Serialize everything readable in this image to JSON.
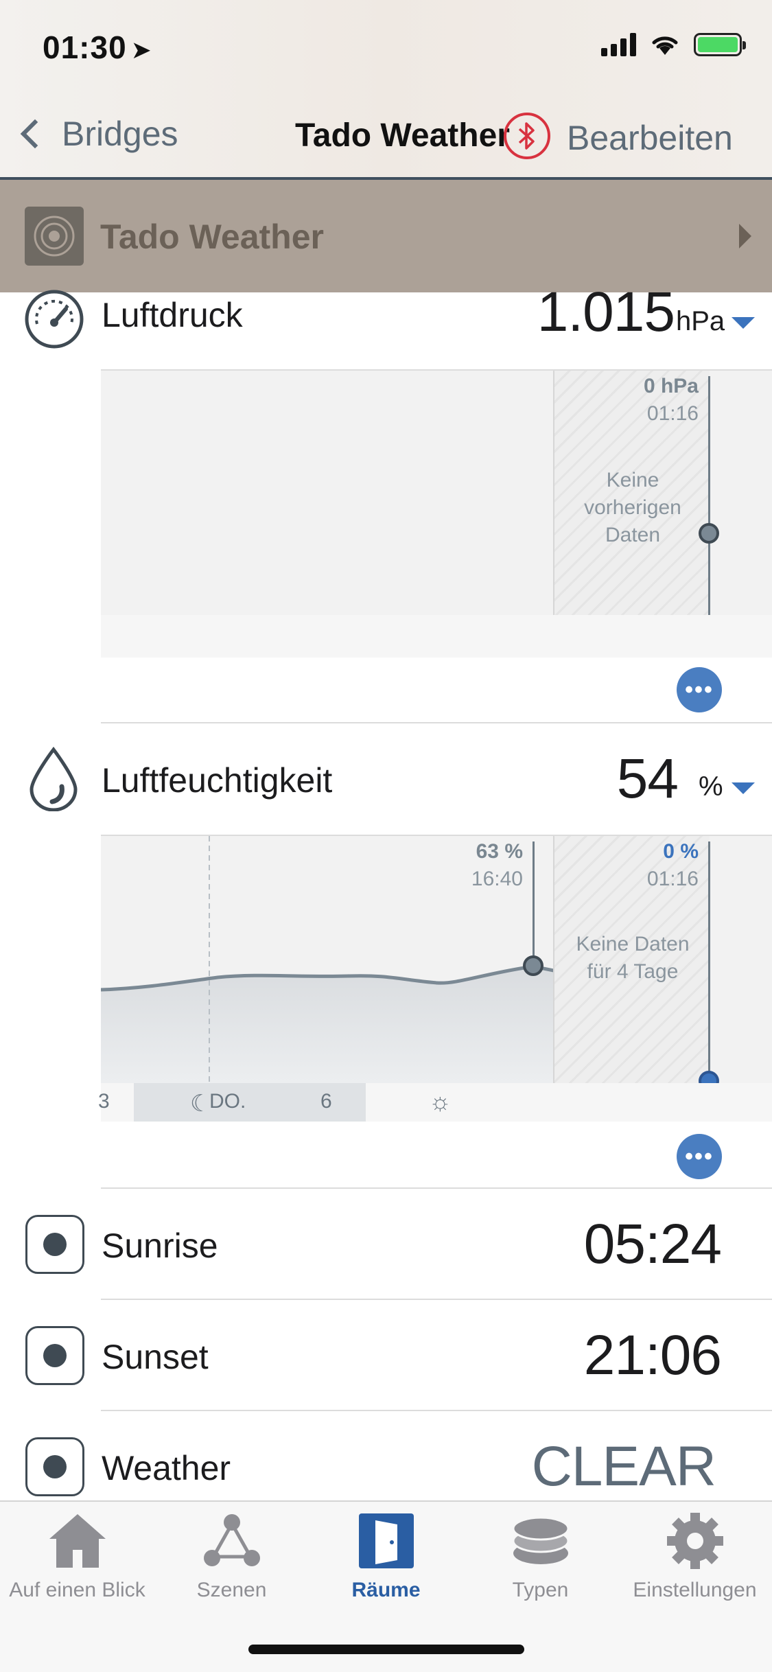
{
  "status_bar": {
    "time": "01:30",
    "location_icon": "location-arrow-icon"
  },
  "nav": {
    "back_label": "Bridges",
    "title": "Tado Weather",
    "edit_label": "Bearbeiten"
  },
  "device": {
    "name": "Tado Weather"
  },
  "pressure": {
    "label": "Luftdruck",
    "value": "1.015",
    "unit": "hPa",
    "marker": {
      "value": "0 hPa",
      "time": "01:16"
    },
    "nodata": {
      "line1": "Keine vorherigen",
      "line2": "Daten"
    }
  },
  "humidity": {
    "label": "Luftfeuchtigkeit",
    "value": "54",
    "unit": "%",
    "marker_left": {
      "value": "63 %",
      "time": "16:40"
    },
    "marker_right": {
      "value": "0 %",
      "time": "01:16"
    },
    "nodata": {
      "line1": "Keine Daten",
      "line2": "für 4 Tage"
    },
    "days": {
      "prev": "3",
      "day": "DO.",
      "num": "6"
    }
  },
  "rows": [
    {
      "label": "Sunrise",
      "value": "05:24"
    },
    {
      "label": "Sunset",
      "value": "21:06"
    },
    {
      "label": "Weather",
      "value": "CLEAR"
    }
  ],
  "tabs": [
    {
      "label": "Auf einen Blick",
      "icon": "house-icon"
    },
    {
      "label": "Szenen",
      "icon": "scenes-icon"
    },
    {
      "label": "Räume",
      "icon": "door-icon"
    },
    {
      "label": "Typen",
      "icon": "layers-icon"
    },
    {
      "label": "Einstellungen",
      "icon": "gear-icon"
    }
  ],
  "colors": {
    "accent": "#3b73bd",
    "band": "#aca197",
    "bluetooth": "#d8323f"
  }
}
